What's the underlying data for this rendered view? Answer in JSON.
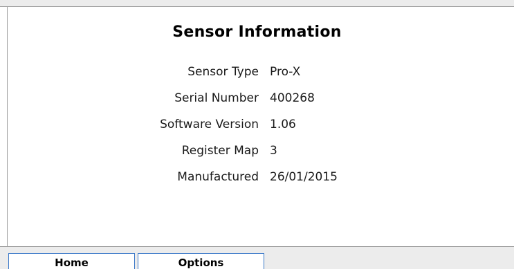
{
  "panel": {
    "title": "Sensor Information",
    "rows": [
      {
        "label": "Sensor Type",
        "value": "Pro-X"
      },
      {
        "label": "Serial Number",
        "value": "400268"
      },
      {
        "label": "Software Version",
        "value": "1.06"
      },
      {
        "label": "Register Map",
        "value": "3"
      },
      {
        "label": "Manufactured",
        "value": "26/01/2015"
      }
    ]
  },
  "tabs": [
    {
      "label": "Home"
    },
    {
      "label": "Options"
    }
  ],
  "colors": {
    "tab_border": "#3b78c8",
    "chrome_background": "#ececec"
  }
}
